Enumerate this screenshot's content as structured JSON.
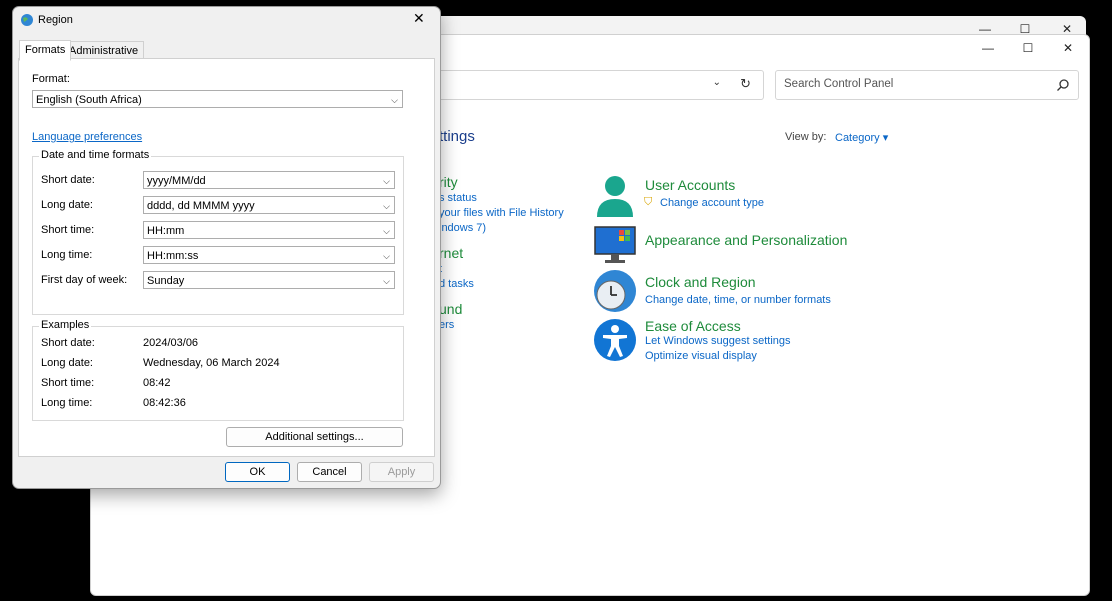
{
  "back_window": {
    "min": "—",
    "max": "☐",
    "close": "✕"
  },
  "control_panel": {
    "min": "—",
    "max": "☐",
    "close": "✕",
    "search_placeholder": "Search Control Panel",
    "heading_fragment": "ttings",
    "view_by_label": "View by:",
    "view_by_value": "Category",
    "left_fragments": {
      "a_title": "rity",
      "a_link1": "s status",
      "a_link2": "your files with File History",
      "a_link3": "indows 7)",
      "b_title": "rnet",
      "b_link1": "t",
      "b_link2": "d tasks",
      "c_title": "und",
      "c_link1": "ers"
    },
    "categories": [
      {
        "title": "User Accounts",
        "links": [
          "Change account type"
        ],
        "icon": "user-accounts-icon"
      },
      {
        "title": "Appearance and Personalization",
        "links": [],
        "icon": "monitor-icon"
      },
      {
        "title": "Clock and Region",
        "links": [
          "Change date, time, or number formats"
        ],
        "icon": "clock-globe-icon"
      },
      {
        "title": "Ease of Access",
        "links": [
          "Let Windows suggest settings",
          "Optimize visual display"
        ],
        "icon": "accessibility-icon"
      }
    ],
    "accent": "#0b67c7",
    "category_color": "#1e8b3b"
  },
  "region_dialog": {
    "title": "Region",
    "tabs": [
      "Formats",
      "Administrative"
    ],
    "format_label": "Format:",
    "format_value": "English (South Africa)",
    "language_link": "Language preferences",
    "datetime_group": "Date and time formats",
    "fields": [
      {
        "label": "Short date:",
        "value": "yyyy/MM/dd"
      },
      {
        "label": "Long date:",
        "value": "dddd, dd MMMM yyyy"
      },
      {
        "label": "Short time:",
        "value": "HH:mm"
      },
      {
        "label": "Long time:",
        "value": "HH:mm:ss"
      },
      {
        "label": "First day of week:",
        "value": "Sunday"
      }
    ],
    "examples_group": "Examples",
    "examples": [
      {
        "label": "Short date:",
        "value": "2024/03/06"
      },
      {
        "label": "Long date:",
        "value": "Wednesday, 06 March 2024"
      },
      {
        "label": "Short time:",
        "value": "08:42"
      },
      {
        "label": "Long time:",
        "value": "08:42:36"
      }
    ],
    "additional_settings": "Additional settings...",
    "ok": "OK",
    "cancel": "Cancel",
    "apply": "Apply"
  }
}
